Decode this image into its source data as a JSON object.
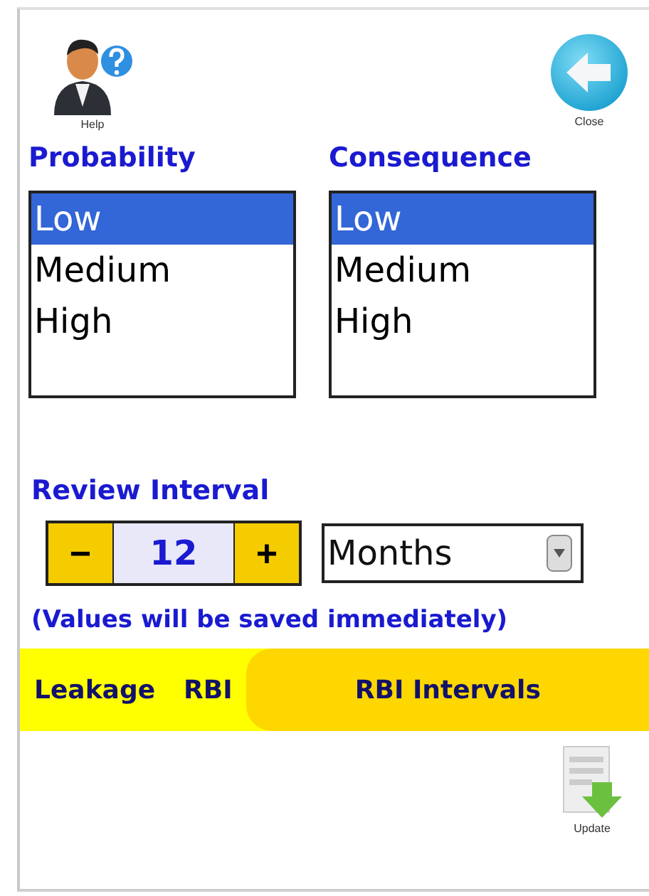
{
  "toolbar": {
    "help_label": "Help",
    "close_label": "Close"
  },
  "probability": {
    "label": "Probability",
    "options": [
      {
        "label": "Low",
        "selected": true
      },
      {
        "label": "Medium",
        "selected": false
      },
      {
        "label": "High",
        "selected": false
      }
    ]
  },
  "consequence": {
    "label": "Consequence",
    "options": [
      {
        "label": "Low",
        "selected": true
      },
      {
        "label": "Medium",
        "selected": false
      },
      {
        "label": "High",
        "selected": false
      }
    ]
  },
  "review_interval": {
    "label": "Review Interval",
    "minus": "−",
    "value": "12",
    "plus": "+",
    "unit": "Months",
    "note": "(Values will be saved immediately)"
  },
  "tabs": [
    {
      "label": "Leakage",
      "selected": false
    },
    {
      "label": "RBI",
      "selected": false
    },
    {
      "label": "RBI Intervals",
      "selected": true
    }
  ],
  "update_label": "Update"
}
